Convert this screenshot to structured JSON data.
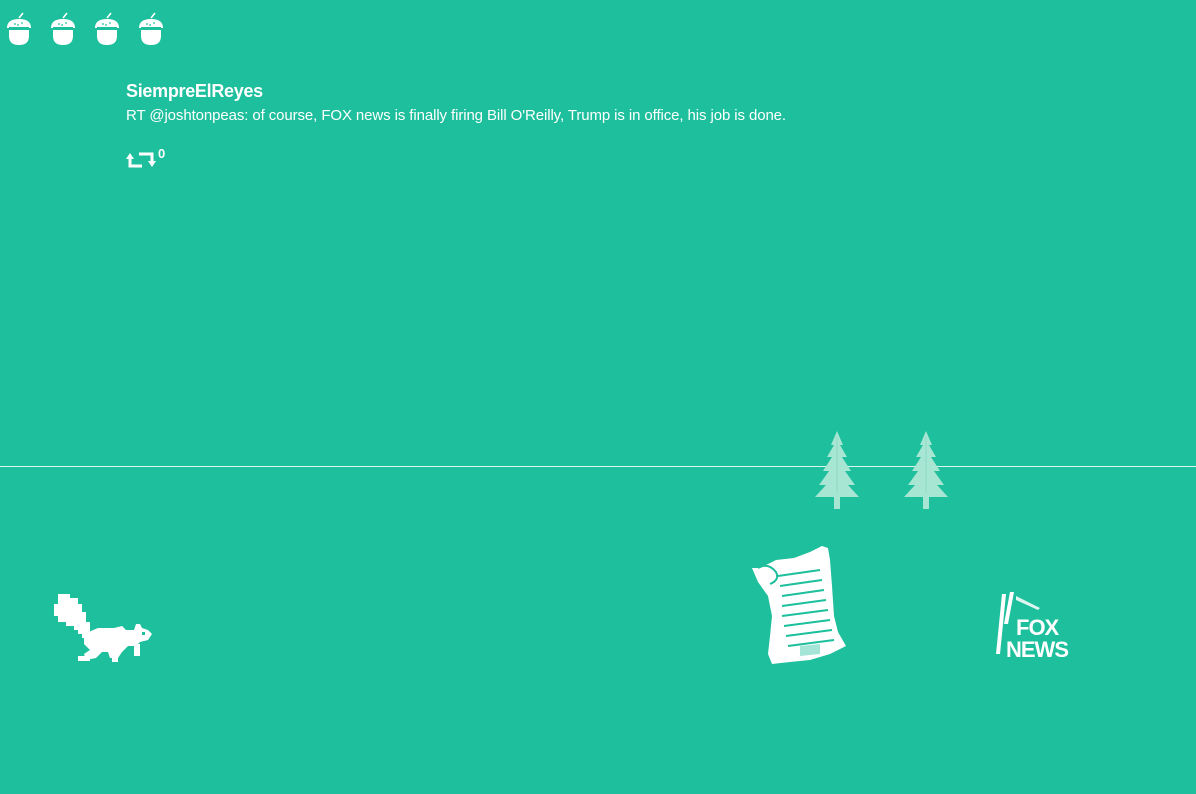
{
  "game": {
    "lives_remaining": 4,
    "lives_icon": "acorn-icon"
  },
  "tweet": {
    "username": "SiempreElReyes",
    "text": "RT @joshtonpeas: of course, FOX news is finally firing Bill O'Reilly,  Trump is in office, his job is done.",
    "retweet_icon": "retweet-icon",
    "retweet_count": "0"
  },
  "scene": {
    "player": "squirrel",
    "obstacles": [
      "newspaper",
      "fox-news-logo"
    ],
    "scenery": [
      "pine-tree",
      "pine-tree"
    ],
    "fox_logo_text": [
      "FOX",
      "NEWS"
    ],
    "colors": {
      "background": "#1dbf9c",
      "sprite": "#ffffff",
      "tree": "#a8e6d4"
    }
  }
}
